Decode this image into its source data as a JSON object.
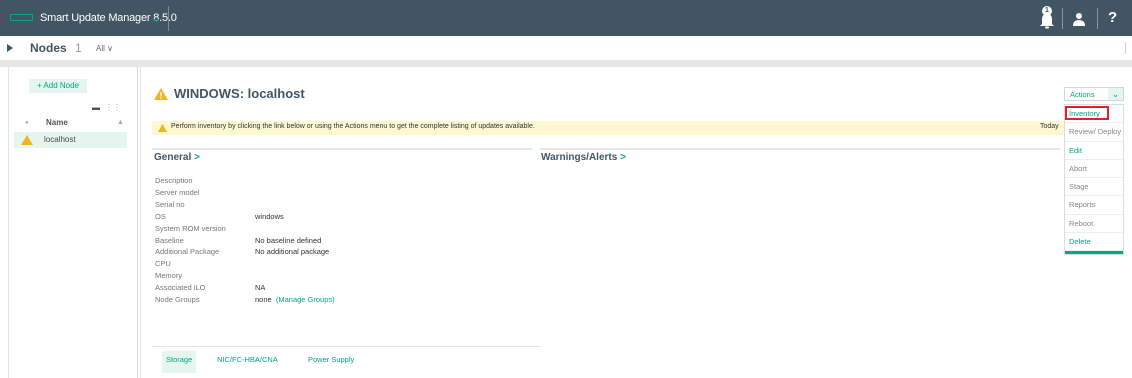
{
  "app": {
    "title": "Smart Update Manager 8.5.0",
    "notification_count": "1"
  },
  "nav": {
    "title": "Nodes",
    "count": "1",
    "filter": "All ∨"
  },
  "sidebar": {
    "add_node": "+ Add Node",
    "column_name": "Name",
    "nodes": [
      {
        "name": "localhost",
        "status": "warning"
      }
    ]
  },
  "node": {
    "title": "WINDOWS: localhost",
    "banner": "Perform inventory by clicking the link below or using the Actions menu to get the complete listing of updates available.",
    "banner_date": "Today"
  },
  "general": {
    "heading": "General",
    "properties": [
      {
        "label": "Description",
        "value": ""
      },
      {
        "label": "Server model",
        "value": ""
      },
      {
        "label": "Serial no",
        "value": ""
      },
      {
        "label": "OS",
        "value": "windows"
      },
      {
        "label": "System ROM version",
        "value": ""
      },
      {
        "label": "Baseline",
        "value": "No baseline defined"
      },
      {
        "label": "Additional Package",
        "value": "No additional package"
      },
      {
        "label": "CPU",
        "value": ""
      },
      {
        "label": "Memory",
        "value": ""
      },
      {
        "label": "Associated iLO",
        "value": "NA"
      },
      {
        "label": "Node Groups",
        "value": "none",
        "link": "(Manage Groups)"
      }
    ]
  },
  "warnings": {
    "heading": "Warnings/Alerts"
  },
  "tabs": [
    "Storage",
    "NIC/FC-HBA/CNA",
    "Power Supply"
  ],
  "actions": {
    "label": "Actions",
    "menu": [
      "Inventory",
      "Review/ Deploy",
      "Edit",
      "Abort",
      "Stage",
      "Reports",
      "Reboot",
      "Delete"
    ]
  },
  "colors": {
    "header": "#425563",
    "accent": "#01a982",
    "banner": "#fdf7d2",
    "highlight": "#d9232d",
    "warning": "#f0b323"
  }
}
